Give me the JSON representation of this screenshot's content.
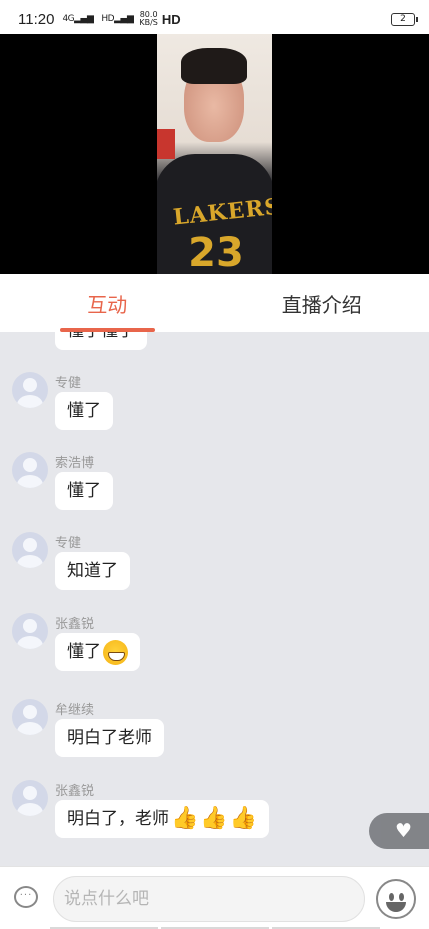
{
  "status_bar": {
    "time": "11:20",
    "signal_1": "4G",
    "signal_2": "HD",
    "net_speed": "80.0",
    "net_unit": "KB/S",
    "hd_label": "HD",
    "battery": "2"
  },
  "video": {
    "jersey_text": "LAKERS",
    "jersey_number": "23"
  },
  "tabs": [
    {
      "label": "互动",
      "active": true
    },
    {
      "label": "直播介绍",
      "active": false
    }
  ],
  "messages": [
    {
      "sender": "",
      "text": "懂了懂了",
      "partial": true
    },
    {
      "sender": "专健",
      "text": "懂了"
    },
    {
      "sender": "索浩博",
      "text": "懂了"
    },
    {
      "sender": "专健",
      "text": "知道了"
    },
    {
      "sender": "张鑫锐",
      "text": "懂了",
      "emoji": "grin-emoji"
    },
    {
      "sender": "牟继续",
      "text": "明白了老师"
    },
    {
      "sender": "张鑫锐",
      "text": "明白了，老师",
      "emoji": "thumbs-up-emoji"
    }
  ],
  "input": {
    "placeholder": "说点什么吧"
  },
  "icons": {
    "comment": "comment-icon",
    "emoji": "smiley-icon",
    "like": "heart-icon"
  },
  "colors": {
    "accent": "#e8654b",
    "chat_bg": "#e6e7eb"
  }
}
